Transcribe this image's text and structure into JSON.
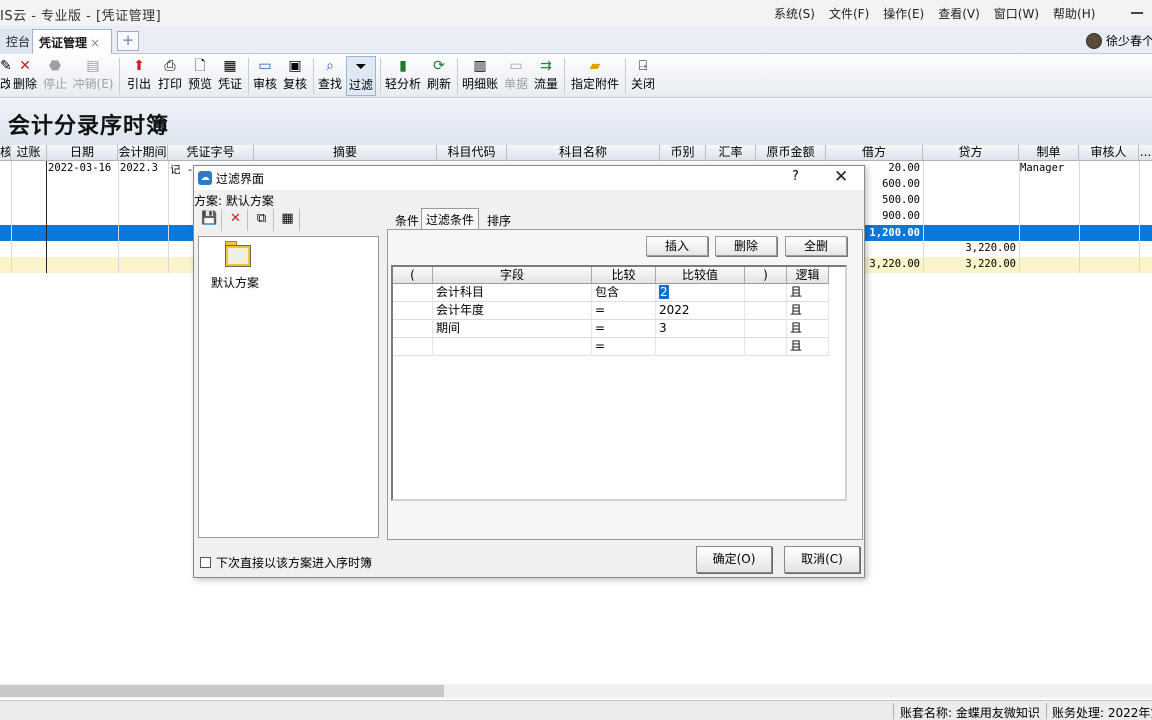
{
  "app": {
    "title": "IS云 - 专业版 - [凭证管理]",
    "menu": [
      "系统(S)",
      "文件(F)",
      "操作(E)",
      "查看(V)",
      "窗口(W)",
      "帮助(H)"
    ]
  },
  "tabs": {
    "workbench": "控台",
    "voucher": "凭证管理",
    "close": "×",
    "add": "+"
  },
  "user": {
    "name": "徐少春个"
  },
  "toolbar": {
    "buttons": [
      "改",
      "删除",
      "停止",
      "冲销(E)",
      "引出",
      "打印",
      "预览",
      "凭证",
      "审核",
      "复核",
      "查找",
      "过滤",
      "轻分析",
      "刷新",
      "明细账",
      "单据",
      "流量",
      "指定附件",
      "关闭"
    ]
  },
  "page": {
    "heading": "会计分录序时簿"
  },
  "grid": {
    "columns": [
      "核",
      "过账",
      "日期",
      "会计期间",
      "凭证字号",
      "摘要",
      "科目代码",
      "科目名称",
      "币别",
      "汇率",
      "原币金额",
      "借方",
      "贷方",
      "制单",
      "审核人",
      "..."
    ],
    "row1": {
      "date": "2022-03-16",
      "period": "2022.3",
      "voucher": "记 -",
      "maker": "Manager"
    },
    "debits": [
      "20.00",
      "600.00",
      "500.00",
      "900.00"
    ],
    "selected_debit": "1,200.00",
    "credit_row": {
      "credit": "3,220.00"
    },
    "sum_row": {
      "debit": "3,220.00",
      "credit": "3,220.00"
    }
  },
  "status": {
    "account": "账套名称: 金蝶用友微知识",
    "process": "账务处理: 2022年第"
  },
  "dialog": {
    "title": "过滤界面",
    "help": "?",
    "close": "✕",
    "scheme_label": "方案: 默认方案",
    "scheme_item": "默认方案",
    "tabs": [
      "条件",
      "过滤条件",
      "排序"
    ],
    "buttons": {
      "insert": "插入",
      "delete": "删除",
      "delete_all": "全删"
    },
    "grid_headers": [
      "(",
      "字段",
      "比较",
      "比较值",
      ")",
      "逻辑"
    ],
    "conditions": [
      {
        "field": "会计科目",
        "op": "包含",
        "value": "2",
        "logic": "且"
      },
      {
        "field": "会计年度",
        "op": "=",
        "value": "2022",
        "logic": "且"
      },
      {
        "field": "期间",
        "op": "=",
        "value": "3",
        "logic": "且"
      },
      {
        "field": "",
        "op": "=",
        "value": "",
        "logic": "且"
      }
    ],
    "checkbox_label": "下次直接以该方案进入序时簿",
    "ok": "确定(O)",
    "cancel": "取消(C)"
  }
}
